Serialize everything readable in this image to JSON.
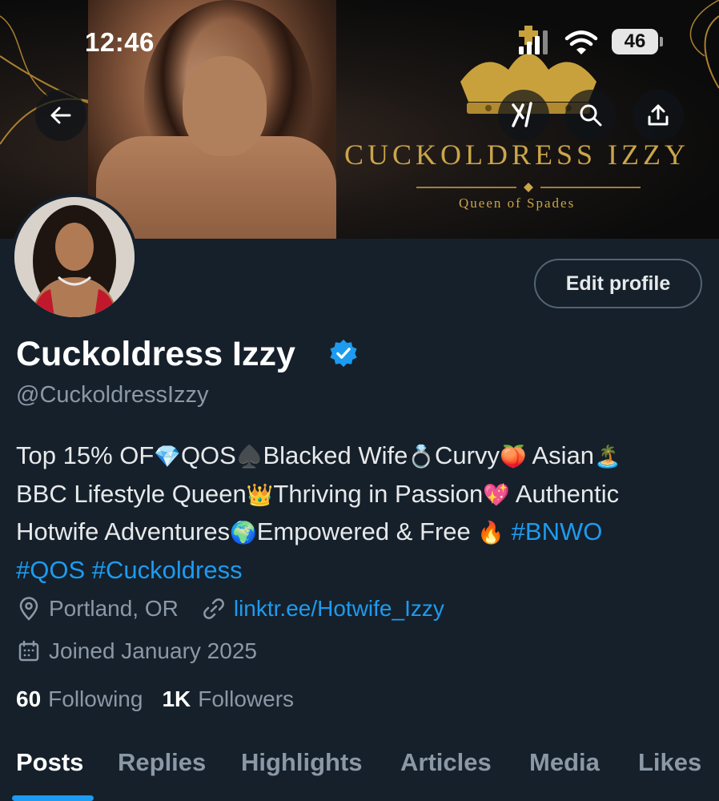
{
  "status_bar": {
    "time": "12:46",
    "battery": "46"
  },
  "banner": {
    "brand_name": "CUCKOLDRESS IZZY",
    "brand_subtitle": "Queen of Spades"
  },
  "profile": {
    "edit_label": "Edit profile",
    "display_name": "Cuckoldress Izzy",
    "handle": "@CuckoldressIzzy",
    "bio": {
      "line1": {
        "a": "Top 15% OF",
        "b": "QOS",
        "c": "Blacked Wife",
        "d": "Curvy",
        "e": "Asian"
      },
      "line2": {
        "a": "BBC Lifestyle Queen",
        "b": "Thriving in Passion",
        "c": "Authentic"
      },
      "line3": {
        "a": "Hotwife Adventures",
        "b": "Empowered & Free",
        "tag": "#BNWO"
      },
      "line4": {
        "tag1": "#QOS",
        "tag2": "#Cuckoldress"
      }
    },
    "location": "Portland, OR",
    "link": "linktr.ee/Hotwife_Izzy",
    "joined": "Joined January 2025",
    "following_count": "60",
    "following_label": "Following",
    "followers_count": "1K",
    "followers_label": "Followers"
  },
  "tabs": [
    "Posts",
    "Replies",
    "Highlights",
    "Articles",
    "Media",
    "Likes"
  ],
  "active_tab": "Posts",
  "icons": {
    "back": "arrow-left-icon",
    "grok": "grok-icon",
    "search": "search-icon",
    "share": "share-icon",
    "verified": "verified-badge-icon",
    "location": "location-pin-icon",
    "link": "link-icon",
    "calendar": "calendar-icon"
  },
  "colors": {
    "background": "#15202b",
    "accent": "#1d9bf0",
    "muted_text": "#8b98a5",
    "gold": "#caa54a"
  }
}
